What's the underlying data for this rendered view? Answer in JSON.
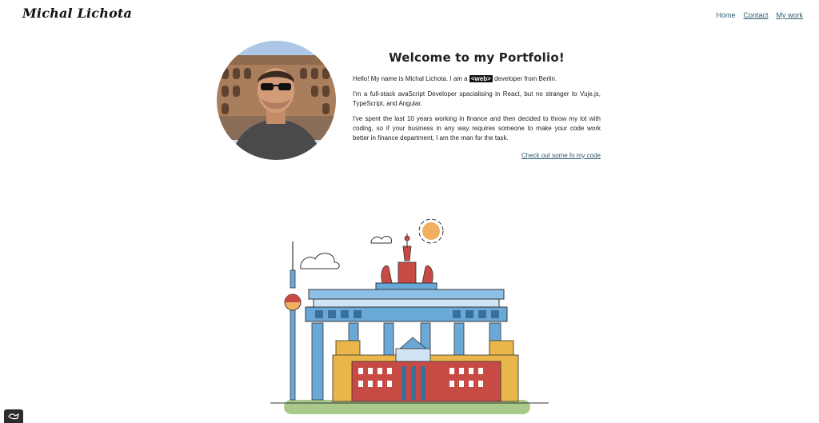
{
  "header": {
    "logo": "Michal Lichota",
    "nav": [
      {
        "label": "Home"
      },
      {
        "label": "Contact"
      },
      {
        "label": "My work"
      }
    ]
  },
  "intro": {
    "title": "Welcome to my Portfolio!",
    "p1_before": "Hello! My name is Michal Lichota. I am a ",
    "p1_tag": "<web>",
    "p1_after": " developer from Berlin.",
    "p2": "I'm a full-stack avaScript Developer spacialising in React, but no stranger to Vuje.js, TypeScript, and Angular.",
    "p3": "I've spent the last 10 years working in finance and then decided to throw my lot with coding, so if your business in any way requires someone to make your code work better in finance department, I am the man for the task.",
    "cta": "Check out some fo my code"
  },
  "colors": {
    "link": "#2f5b6f",
    "accent_orange": "#f0b060",
    "accent_red": "#c84a45",
    "accent_blue": "#6aa8d8",
    "ground_green": "#a9c98a"
  },
  "icons": {
    "badge": "chat-icon"
  }
}
